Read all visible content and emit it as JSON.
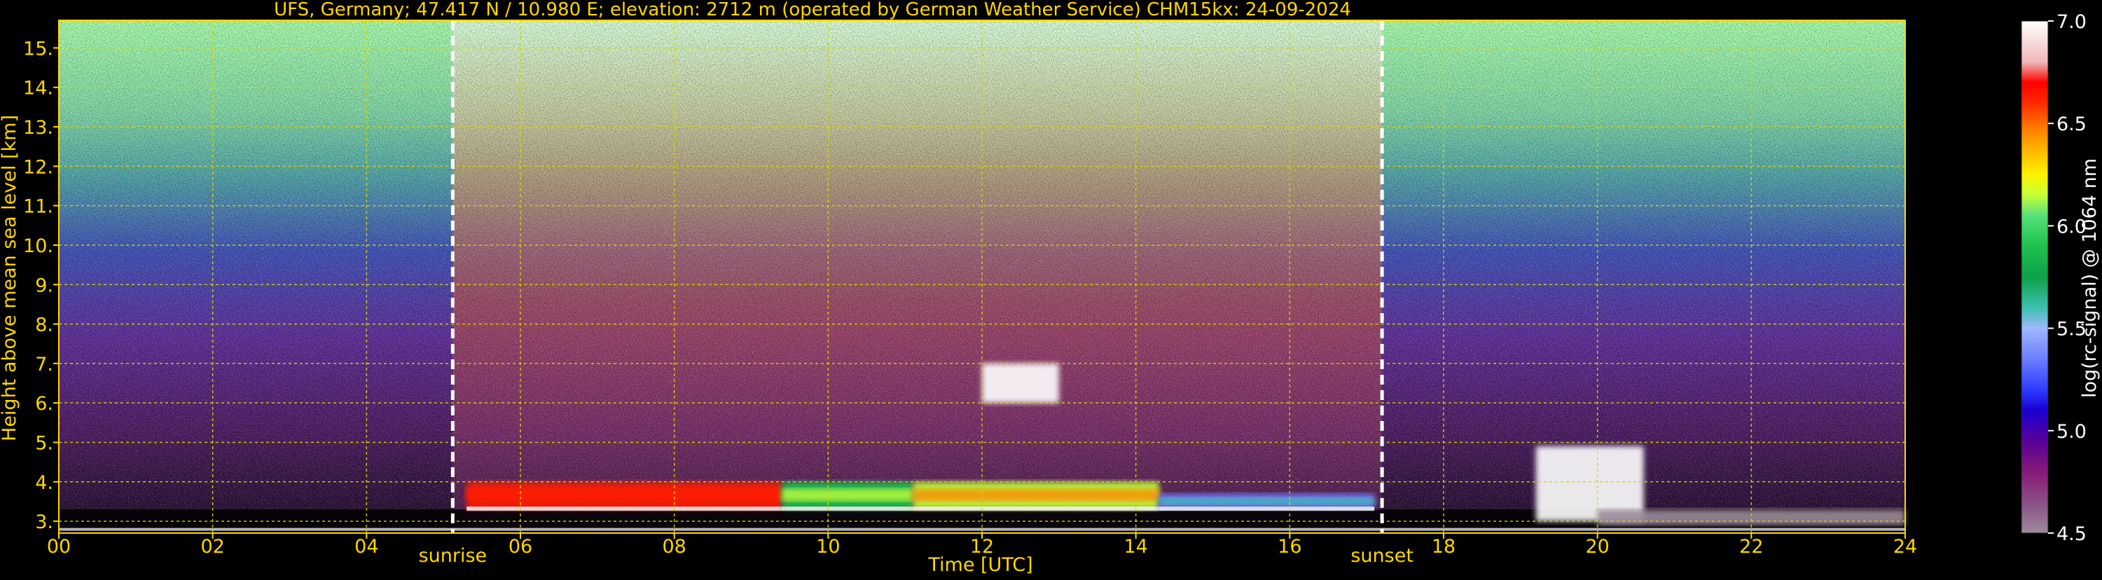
{
  "chart_data": {
    "type": "heatmap",
    "title": "UFS, Germany; 47.417 N / 10.980 E; elevation: 2712 m  (operated by German Weather Service)    CHM15kx: 24-09-2024",
    "xlabel": "Time [UTC]",
    "ylabel": "Height above mean sea level [km]",
    "colorbar_label": "log(rc-signal) @ 1064 nm",
    "xlim": [
      0,
      24
    ],
    "ylim": [
      2.7,
      15.7
    ],
    "x_ticks": [
      0,
      2,
      4,
      6,
      8,
      10,
      12,
      14,
      16,
      18,
      20,
      22,
      24
    ],
    "x_tick_labels": [
      "00",
      "02",
      "04",
      "06",
      "08",
      "10",
      "12",
      "14",
      "16",
      "18",
      "20",
      "22",
      "24"
    ],
    "y_ticks": [
      3,
      4,
      5,
      6,
      7,
      8,
      9,
      10,
      11,
      12,
      13,
      14,
      15
    ],
    "y_tick_labels": [
      "3.",
      "4.",
      "5.",
      "6.",
      "7.",
      "8.",
      "9.",
      "10.",
      "11.",
      "12.",
      "13.",
      "14.",
      "15."
    ],
    "colorbar_range": [
      4.5,
      7.0
    ],
    "colorbar_ticks": [
      4.5,
      5.0,
      5.5,
      6.0,
      6.5,
      7.0
    ],
    "colorbar_tick_labels": [
      "4.5",
      "5.0",
      "5.5",
      "6.0",
      "6.5",
      "7.0"
    ],
    "grid": true,
    "markers": [
      {
        "label": "sunrise",
        "time": 5.12
      },
      {
        "label": "sunset",
        "time": 17.2
      }
    ],
    "features": [
      {
        "kind": "boundary_layer",
        "start": 5.3,
        "end": 9.4,
        "top": 4.0,
        "bottom": 3.3,
        "level": 6.5
      },
      {
        "kind": "boundary_layer",
        "start": 9.4,
        "end": 11.1,
        "top": 4.0,
        "bottom": 3.3,
        "level": 5.9
      },
      {
        "kind": "boundary_layer",
        "start": 11.1,
        "end": 14.3,
        "top": 4.0,
        "bottom": 3.3,
        "level": 6.1
      },
      {
        "kind": "boundary_layer",
        "start": 14.3,
        "end": 17.1,
        "top": 3.7,
        "bottom": 3.3,
        "level": 5.3
      },
      {
        "kind": "cloud_layer",
        "start": 19.2,
        "end": 20.6,
        "top": 4.9,
        "bottom": 3.0,
        "level": 7.0
      },
      {
        "kind": "residual_layer",
        "start": 20.0,
        "end": 24.0,
        "top": 3.3,
        "bottom": 2.9,
        "level": 4.7
      },
      {
        "kind": "cloud_patch",
        "start": 12.0,
        "end": 13.0,
        "top": 7.0,
        "bottom": 6.0,
        "level": 7.0
      }
    ]
  },
  "style": {
    "axis_color": "#ffd700",
    "title_color": "#ffd700",
    "colorbar_text_color": "#ffffff",
    "marker_color": "#ffffff",
    "grid_color": "#d6d600"
  }
}
